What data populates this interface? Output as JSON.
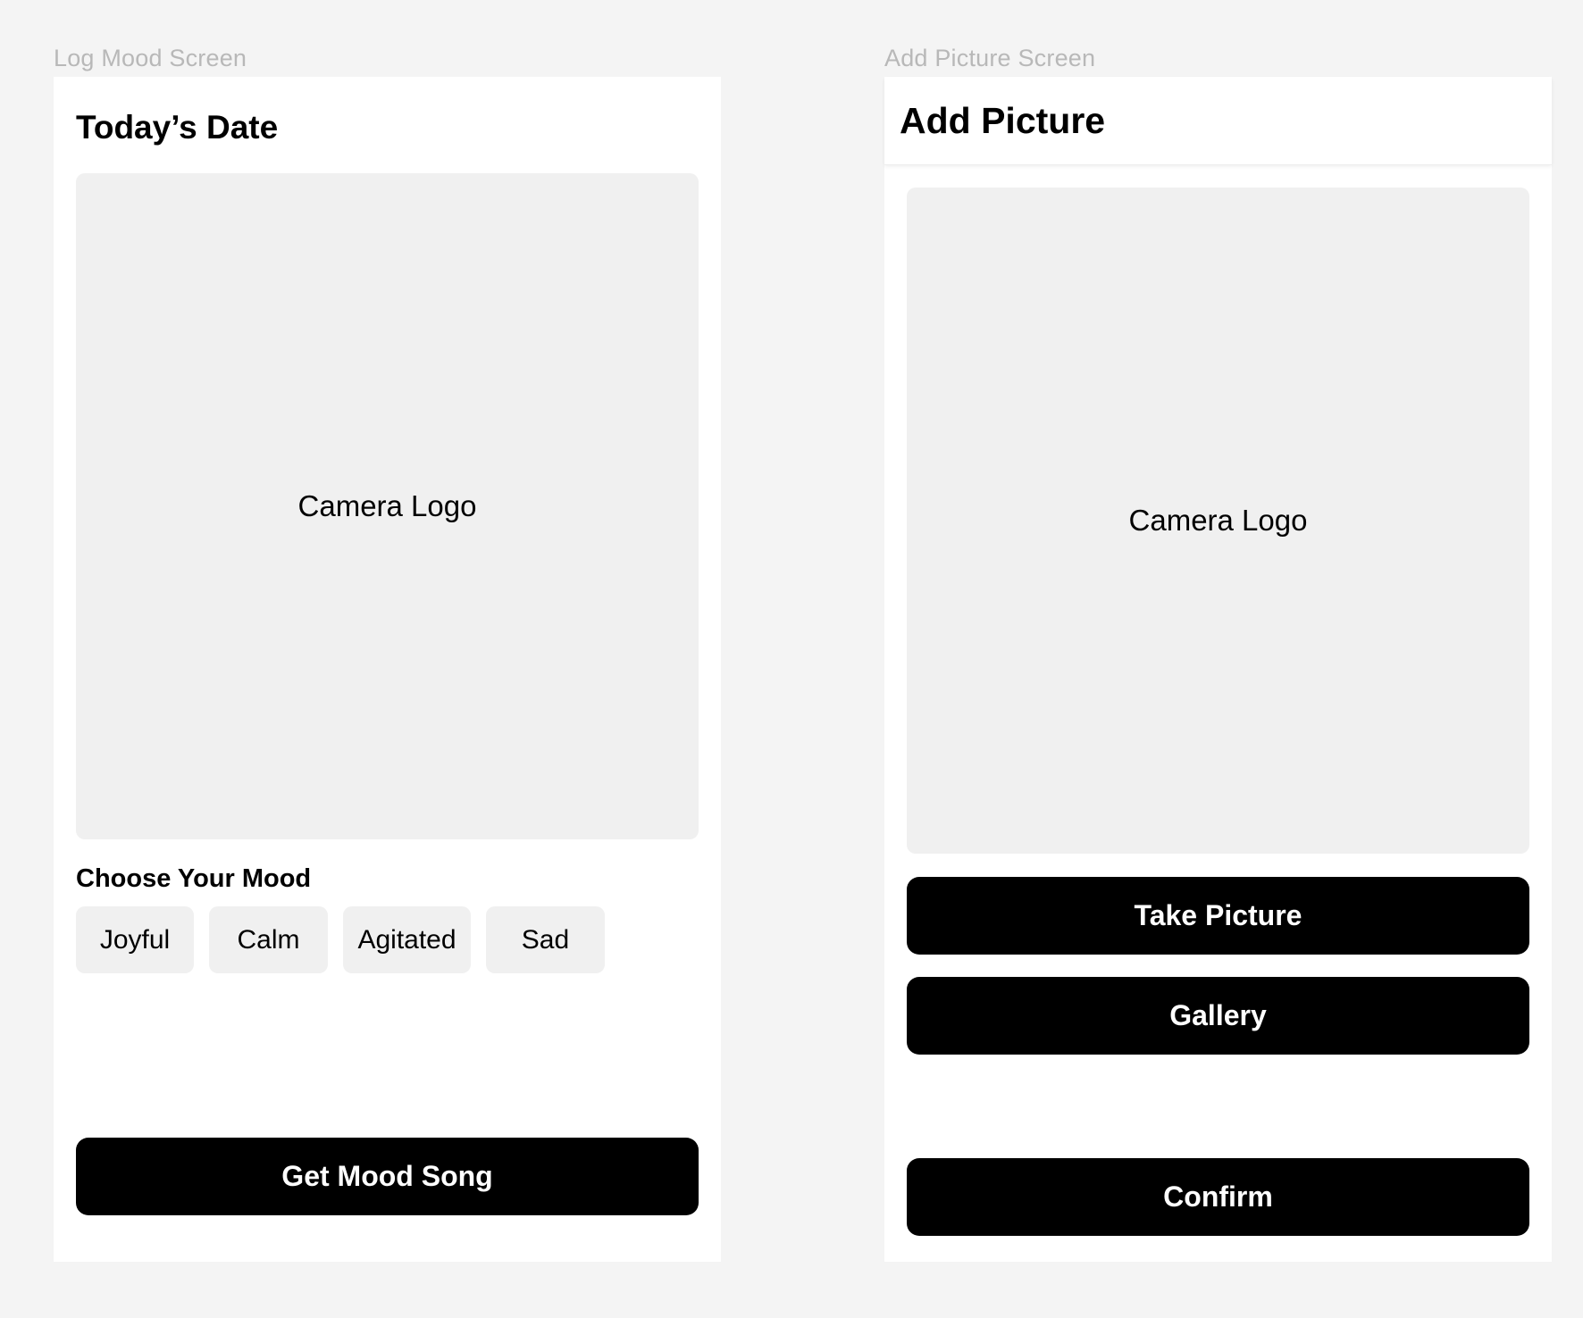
{
  "log_mood_screen": {
    "frame_label": "Log Mood Screen",
    "title": "Today’s Date",
    "photo_placeholder": "Camera Logo",
    "mood_heading": "Choose Your Mood",
    "moods": [
      "Joyful",
      "Calm",
      "Agitated",
      "Sad"
    ],
    "primary_button": "Get Mood Song"
  },
  "add_picture_screen": {
    "frame_label": "Add Picture Screen",
    "title": "Add Picture",
    "photo_placeholder": "Camera Logo",
    "take_picture_button": "Take Picture",
    "gallery_button": "Gallery",
    "confirm_button": "Confirm"
  },
  "colors": {
    "canvas": "#f4f4f4",
    "frame": "#ffffff",
    "placeholder": "#f0f0f0",
    "button": "#000000",
    "button_text": "#ffffff",
    "frame_label": "#b8b8b8"
  }
}
